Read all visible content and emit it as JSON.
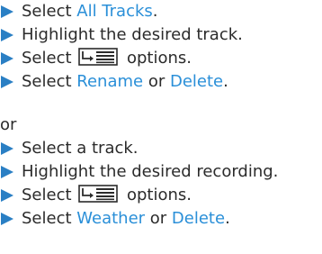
{
  "group1": {
    "step1": {
      "prefix": "Select ",
      "link": "All Tracks",
      "suffix": "."
    },
    "step2": {
      "text": "Highlight the desired track."
    },
    "step3": {
      "prefix": "Select ",
      "suffix": " options."
    },
    "step4": {
      "prefix": "Select ",
      "link1": "Rename",
      "middle": " or ",
      "link2": "Delete",
      "suffix": "."
    }
  },
  "separator": "or",
  "group2": {
    "step1": {
      "text": "Select a track."
    },
    "step2": {
      "text": "Highlight the desired recording."
    },
    "step3": {
      "prefix": "Select ",
      "suffix": " options."
    },
    "step4": {
      "prefix": "Select ",
      "link1": "Weather",
      "middle": " or ",
      "link2": "Delete",
      "suffix": "."
    }
  },
  "icons": {
    "bullet": "step-arrow-icon",
    "options": "options-menu-icon"
  },
  "colors": {
    "bullet": "#2a7fc4",
    "link": "#2a8fd8",
    "text": "#2b2b2b"
  }
}
